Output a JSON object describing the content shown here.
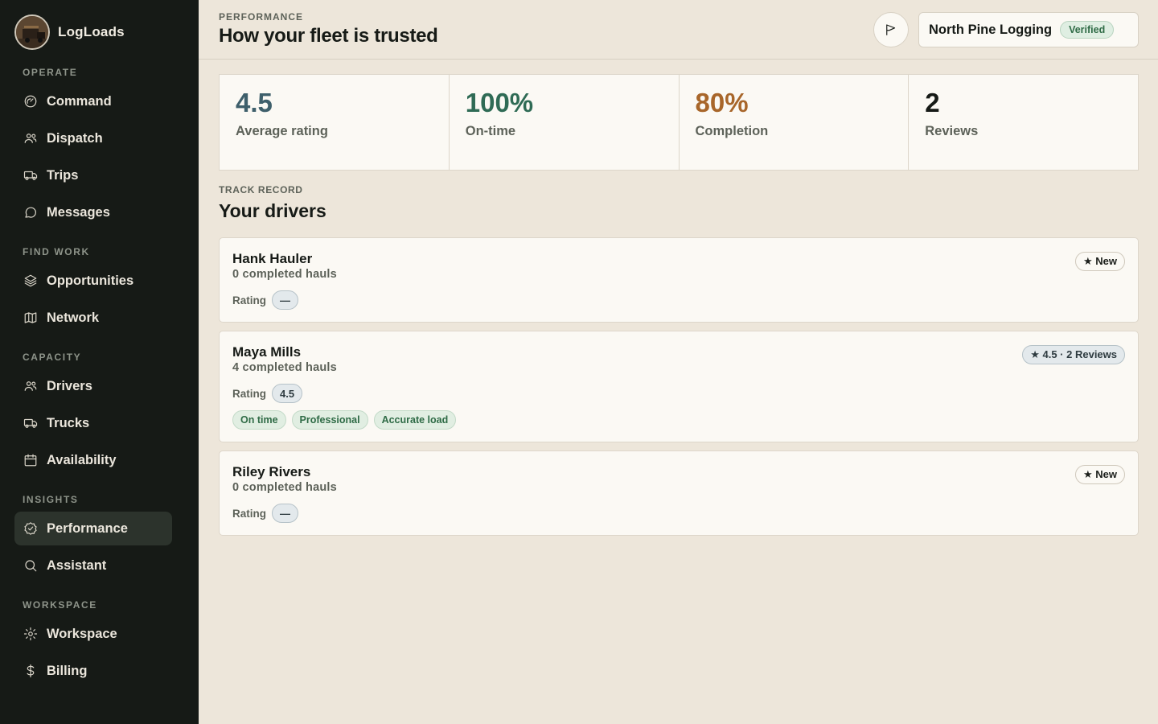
{
  "app": {
    "name": "LogLoads"
  },
  "sidebar": {
    "sections": [
      {
        "label": "OPERATE",
        "items": [
          {
            "label": "Command",
            "icon": "gauge-icon"
          },
          {
            "label": "Dispatch",
            "icon": "users-icon"
          },
          {
            "label": "Trips",
            "icon": "truck-icon"
          },
          {
            "label": "Messages",
            "icon": "chat-icon"
          }
        ]
      },
      {
        "label": "FIND WORK",
        "items": [
          {
            "label": "Opportunities",
            "icon": "layers-icon"
          },
          {
            "label": "Network",
            "icon": "map-icon"
          }
        ]
      },
      {
        "label": "CAPACITY",
        "items": [
          {
            "label": "Drivers",
            "icon": "users-icon"
          },
          {
            "label": "Trucks",
            "icon": "truck-icon"
          },
          {
            "label": "Availability",
            "icon": "calendar-icon"
          }
        ]
      },
      {
        "label": "INSIGHTS",
        "items": [
          {
            "label": "Performance",
            "icon": "badge-check-icon",
            "active": true
          },
          {
            "label": "Assistant",
            "icon": "search-icon"
          }
        ]
      },
      {
        "label": "WORKSPACE",
        "items": [
          {
            "label": "Workspace",
            "icon": "gear-icon"
          },
          {
            "label": "Billing",
            "icon": "dollar-icon"
          }
        ]
      }
    ]
  },
  "header": {
    "eyebrow": "PERFORMANCE",
    "title": "How your fleet is trusted",
    "org_name": "North Pine Logging",
    "verified_label": "Verified"
  },
  "stats": [
    {
      "value": "4.5",
      "label": "Average rating",
      "color": "#3e5f6b"
    },
    {
      "value": "100%",
      "label": "On-time",
      "color": "#2f6b55"
    },
    {
      "value": "80%",
      "label": "Completion",
      "color": "#a8662a"
    },
    {
      "value": "2",
      "label": "Reviews",
      "color": "#161a16"
    }
  ],
  "drivers_section": {
    "eyebrow": "TRACK RECORD",
    "title": "Your drivers",
    "rating_label": "Rating"
  },
  "drivers": [
    {
      "name": "Hank Hauler",
      "hauls": "0 completed hauls",
      "rating": "—",
      "badge": "★ New",
      "badge_type": "new",
      "tags": []
    },
    {
      "name": "Maya Mills",
      "hauls": "4 completed hauls",
      "rating": "4.5",
      "badge": "★ 4.5 · 2 Reviews",
      "badge_type": "review",
      "tags": [
        "On time",
        "Professional",
        "Accurate load"
      ]
    },
    {
      "name": "Riley Rivers",
      "hauls": "0 completed hauls",
      "rating": "—",
      "badge": "★ New",
      "badge_type": "new",
      "tags": []
    }
  ]
}
